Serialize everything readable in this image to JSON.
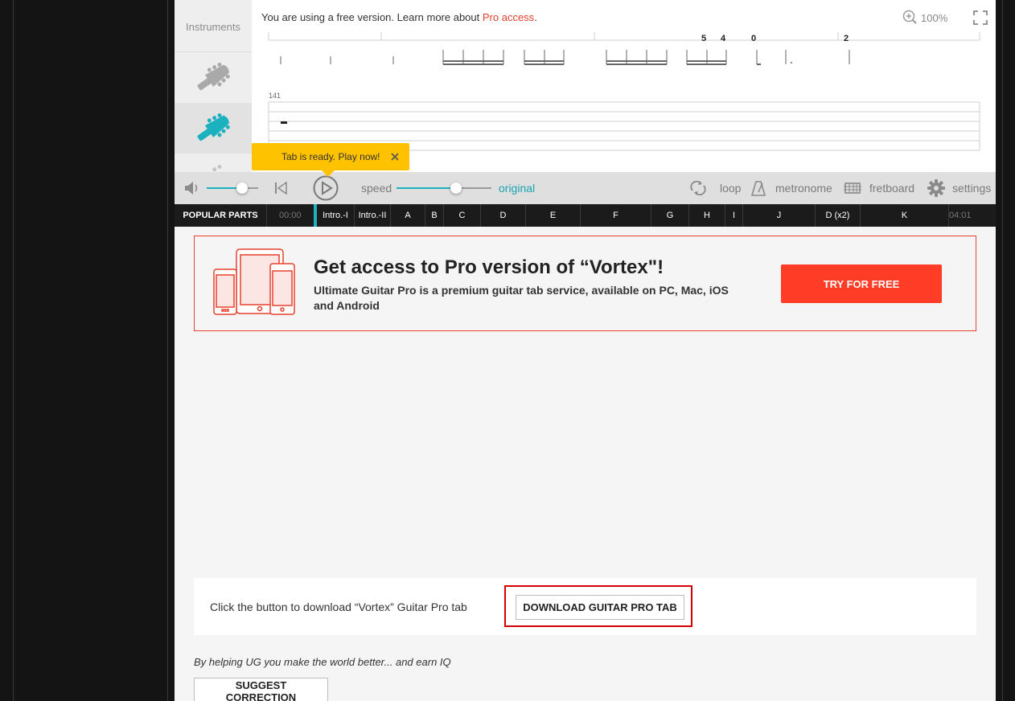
{
  "instruments": {
    "label": "Instruments"
  },
  "notice": {
    "text": "You are using a free version. Learn more about ",
    "link": "Pro access",
    "suffix": "."
  },
  "zoom": {
    "value": "100%"
  },
  "notation": {
    "frets": [
      "5",
      "4",
      "0",
      "2"
    ],
    "bar_number": "141"
  },
  "toast": {
    "text": "Tab is ready. Play now!"
  },
  "controls": {
    "speed_label": "speed",
    "speed_value": "original",
    "loop": "loop",
    "metronome": "metronome",
    "fretboard": "fretboard",
    "settings": "settings"
  },
  "parts": {
    "label": "POPULAR PARTS",
    "start_time": "00:00",
    "end_time": "04:01",
    "items": [
      "Intro.-I",
      "Intro.-II",
      "A",
      "B",
      "C",
      "D",
      "E",
      "F",
      "G",
      "H",
      "I",
      "J",
      "D (x2)",
      "K"
    ]
  },
  "promo": {
    "title": "Get access to Pro version of “Vortex\"!",
    "description": "Ultimate Guitar Pro is a premium guitar tab service, available on PC, Mac, iOS and Android",
    "button": "TRY FOR FREE"
  },
  "download": {
    "text": "Click the button to download “Vortex” Guitar Pro tab",
    "button": "DOWNLOAD GUITAR PRO TAB"
  },
  "help": {
    "text": "By helping UG you make the world better... and earn IQ",
    "button": "SUGGEST CORRECTION"
  },
  "colors": {
    "accent": "#1bb1be",
    "pro_red": "#ff3d26",
    "toast": "#ffc200"
  }
}
